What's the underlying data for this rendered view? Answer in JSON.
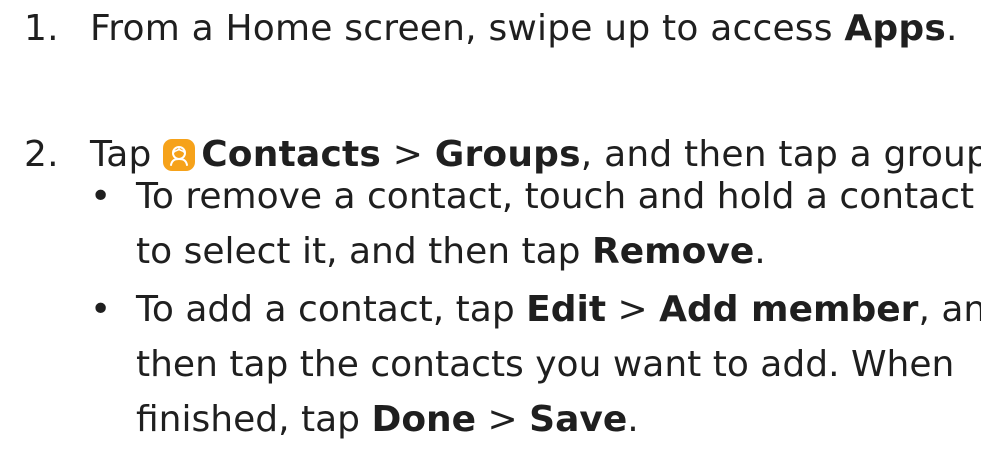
{
  "step1": {
    "number": "1.",
    "text_before": "From a Home screen, swipe up to access ",
    "bold_apps": "Apps",
    "text_after": "."
  },
  "step2": {
    "number": "2.",
    "tap": "Tap ",
    "contacts": "Contacts",
    "sep1": " > ",
    "groups": "Groups",
    "rest": ", and then tap a group.",
    "icon": "contacts-app-icon",
    "icon_color": "#f6a21a"
  },
  "bullet1": {
    "marker": "•",
    "line1": "To remove a contact, touch and hold a contact",
    "line2_before": "to select it, and then tap ",
    "remove": "Remove",
    "line2_after": "."
  },
  "bullet2": {
    "marker": "•",
    "line1_before": "To add a contact, tap ",
    "edit": "Edit",
    "sep": " > ",
    "add_member": "Add member",
    "line1_after": ", and",
    "line2": "then tap the contacts you want to add. When",
    "line3_before": "finished, tap ",
    "done": "Done",
    "sep2": " > ",
    "save": "Save",
    "line3_after": "."
  }
}
